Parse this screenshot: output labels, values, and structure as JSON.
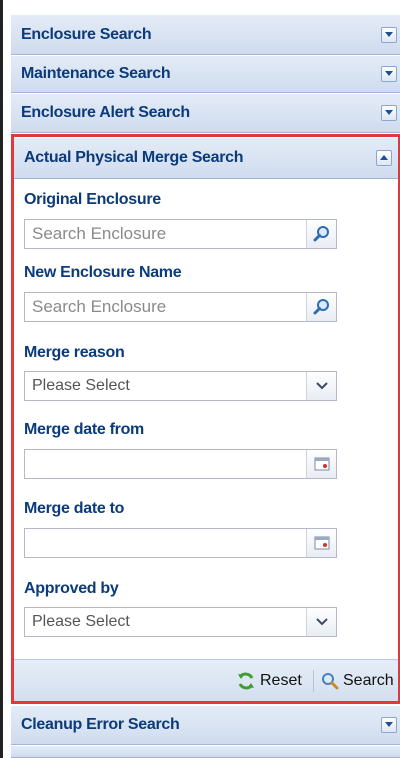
{
  "panels": {
    "enclosure_search": "Enclosure Search",
    "maintenance_search": "Maintenance Search",
    "enclosure_alert_search": "Enclosure Alert Search",
    "cleanup_error_search": "Cleanup Error Search"
  },
  "active": {
    "title": "Actual Physical Merge Search",
    "original_enclosure": {
      "label": "Original Enclosure",
      "placeholder": "Search Enclosure"
    },
    "new_enclosure_name": {
      "label": "New Enclosure Name",
      "placeholder": "Search Enclosure"
    },
    "merge_reason": {
      "label": "Merge reason",
      "value": "Please Select"
    },
    "merge_date_from": {
      "label": "Merge date from",
      "value": ""
    },
    "merge_date_to": {
      "label": "Merge date to",
      "value": ""
    },
    "approved_by": {
      "label": "Approved by",
      "value": "Please Select"
    },
    "footer": {
      "reset_label": "Reset",
      "search_label": "Search"
    }
  },
  "colors": {
    "header_text": "#0b3b7a",
    "active_border": "#e0383c",
    "header_bg": "#d8e3f3"
  },
  "icons": {
    "collapse": "chevron-down-icon",
    "expand": "chevron-up-icon",
    "search": "magnifier-icon",
    "calendar": "calendar-icon",
    "select": "chevron-down-icon",
    "reset": "refresh-icon"
  }
}
